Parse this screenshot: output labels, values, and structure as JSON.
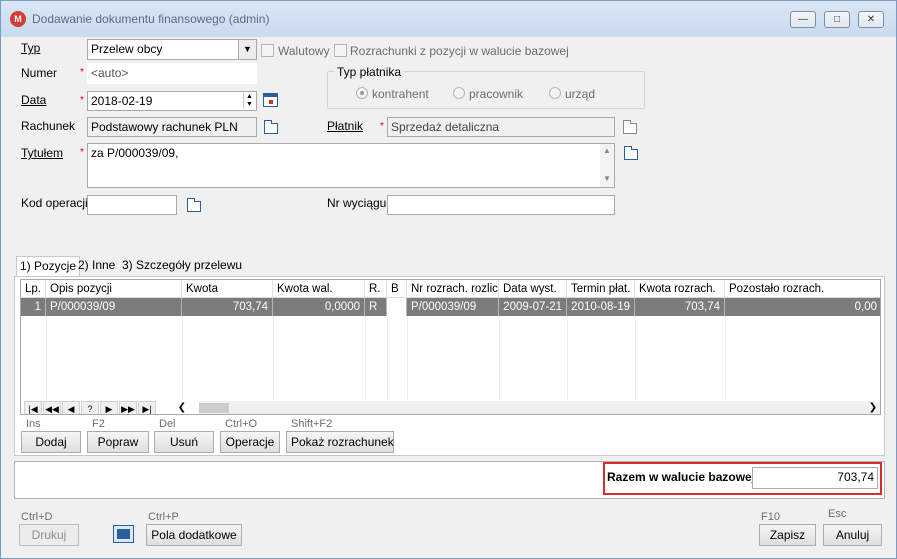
{
  "window": {
    "title": "Dodawanie dokumentu finansowego (admin)",
    "app_icon": "M"
  },
  "form": {
    "typ": {
      "label": "Typ",
      "value": "Przelew obcy"
    },
    "walutowy_label": "Walutowy",
    "rozrachunki_label": "Rozrachunki z pozycji w walucie bazowej",
    "numer": {
      "label": "Numer",
      "value": "<auto>"
    },
    "data": {
      "label": "Data",
      "value": "2018-02-19"
    },
    "rachunek": {
      "label": "Rachunek",
      "value": "Podstawowy rachunek PLN"
    },
    "tytulem": {
      "label": "Tytułem",
      "value": "za P/000039/09,"
    },
    "kod_operacji": {
      "label": "Kod operacji",
      "value": ""
    },
    "typ_platnika": {
      "label": "Typ płatnika",
      "options": [
        "kontrahent",
        "pracownik",
        "urząd"
      ],
      "selected": "kontrahent"
    },
    "platnik": {
      "label": "Płatnik",
      "value": "Sprzedaż detaliczna"
    },
    "nr_wyciagu": {
      "label": "Nr wyciągu",
      "value": ""
    }
  },
  "tabs": [
    "1) Pozycje",
    "2) Inne",
    "3) Szczegóły przelewu"
  ],
  "grid": {
    "columns": [
      "Lp.",
      "Opis pozycji",
      "Kwota",
      "Kwota wal.",
      "R.",
      "B",
      "Nr rozrach. rozlicz",
      "Data wyst.",
      "Termin płat.",
      "Kwota rozrach.",
      "Pozostało rozrach."
    ],
    "rows": [
      [
        "1",
        "P/000039/09",
        "703,74",
        "0,0000",
        "R",
        "",
        "P/000039/09",
        "2009-07-21",
        "2010-08-19",
        "703,74",
        "0,00"
      ]
    ],
    "nav": [
      "|◀",
      "◀◀",
      "◀",
      "?",
      "▶",
      "▶▶",
      "▶|"
    ]
  },
  "actions": [
    {
      "hint": "Ins",
      "label": "Dodaj"
    },
    {
      "hint": "F2",
      "label": "Popraw"
    },
    {
      "hint": "Del",
      "label": "Usuń"
    },
    {
      "hint": "Ctrl+O",
      "label": "Operacje"
    },
    {
      "hint": "Shift+F2",
      "label": "Pokaż rozrachunek"
    }
  ],
  "total": {
    "label": "Razem w walucie bazowej",
    "value": "703,74",
    "highlight_color": "#d32f2f"
  },
  "footer": {
    "drukuj": {
      "hint": "Ctrl+D",
      "label": "Drukuj"
    },
    "pola": {
      "hint": "Ctrl+P",
      "label": "Pola dodatkowe"
    },
    "zapisz": {
      "hint": "F10",
      "label": "Zapisz"
    },
    "anuluj": {
      "hint": "Esc",
      "label": "Anuluj"
    }
  }
}
